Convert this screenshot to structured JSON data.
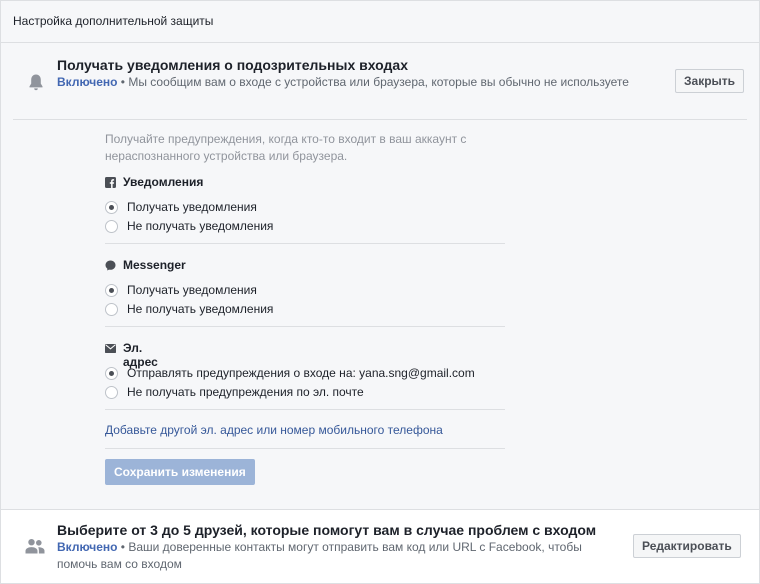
{
  "header": {
    "title": "Настройка дополнительной защиты"
  },
  "alerts": {
    "title": "Получать уведомления о подозрительных входах",
    "status_enabled": "Включено",
    "status_separator": " • ",
    "status_text": "Мы сообщим вам о входе с устройства или браузера, которые вы обычно не используете",
    "close_label": "Закрыть",
    "description": "Получайте предупреждения, когда кто-то входит в ваш аккаунт с нераспознанного устройства или браузера.",
    "groups": [
      {
        "title": "Уведомления",
        "icon": "facebook-icon",
        "options": [
          {
            "label": "Получать уведомления",
            "checked": true
          },
          {
            "label": "Не получать уведомления",
            "checked": false
          }
        ]
      },
      {
        "title": "Messenger",
        "icon": "messenger-icon",
        "options": [
          {
            "label": "Получать уведомления",
            "checked": true
          },
          {
            "label": "Не получать уведомления",
            "checked": false
          }
        ]
      },
      {
        "title": "Эл. адрес",
        "icon": "envelope-icon",
        "options": [
          {
            "label": "Отправлять предупреждения о входе на: yana.sng@gmail.com",
            "checked": true
          },
          {
            "label": "Не получать предупреждения по эл. почте",
            "checked": false
          }
        ]
      }
    ],
    "add_link": "Добавьте другой эл. адрес или номер мобильного телефона",
    "save_label": "Сохранить изменения"
  },
  "trusted": {
    "title": "Выберите от 3 до 5 друзей, которые помогут вам в случае проблем с входом",
    "status_enabled": "Включено",
    "status_separator": " • ",
    "status_text": "Ваши доверенные контакты могут отправить вам код или URL с Facebook, чтобы помочь вам со входом",
    "edit_label": "Редактировать"
  },
  "colors": {
    "accent": "#4267b2",
    "link": "#365899",
    "save_disabled": "#9cb4d8",
    "border": "#dddfe2"
  }
}
